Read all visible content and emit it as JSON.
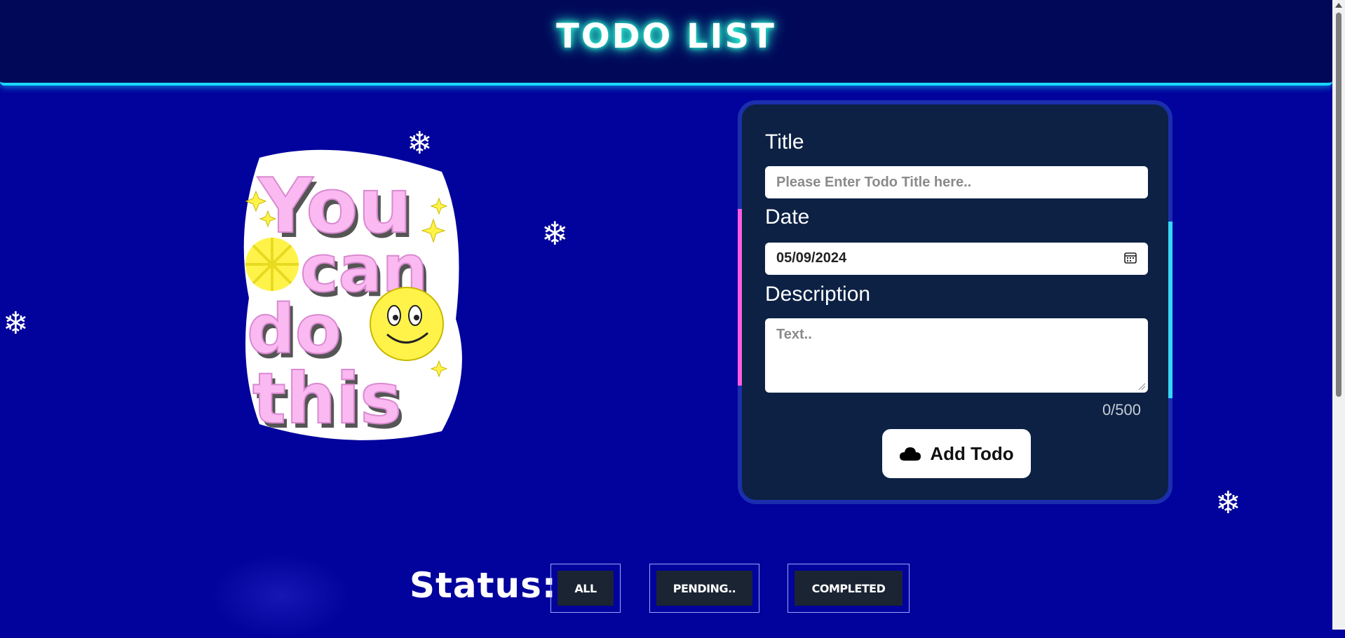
{
  "header": {
    "title": "TODO LIST"
  },
  "sticker": {
    "lines": [
      "You",
      "can",
      "do",
      "this"
    ]
  },
  "form": {
    "title_label": "Title",
    "title_placeholder": "Please Enter Todo Title here..",
    "date_label": "Date",
    "date_value": "05/09/2024",
    "description_label": "Description",
    "description_placeholder": "Text..",
    "char_count": "0/500",
    "add_button_label": "Add Todo"
  },
  "status": {
    "label": "Status:",
    "filters": [
      "ALL",
      "PENDING..",
      "COMPLETED"
    ]
  },
  "colors": {
    "background": "#02029c",
    "header": "#010858",
    "card": "#0c2144",
    "neon_cyan": "#1ad6ff",
    "accent_pink": "#ff5ce0",
    "sticker_pink": "#fbb9f2",
    "smiley_yellow": "#fff34a"
  },
  "icons": [
    "snowflake-icon",
    "calendar-icon",
    "cloud-icon",
    "smiley-icon",
    "sparkle-icon"
  ]
}
